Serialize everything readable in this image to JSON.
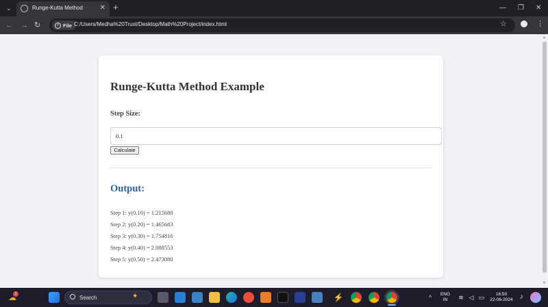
{
  "browser": {
    "tab_title": "Runge-Kutta Method",
    "site_chip": "File",
    "url": "C:/Users/Medha%20Trust/Desktop/Math%20Project/index.html"
  },
  "page": {
    "title": "Runge-Kutta Method Example",
    "step_size_label": "Step Size:",
    "step_size_value": "0.1",
    "calculate_label": "Calculate",
    "output_heading": "Output:",
    "results": [
      "Step 1: y(0.10) = 1.215688",
      "Step 2: y(0.20) = 1.465683",
      "Step 3: y(0.30) = 1.754816",
      "Step 4: y(0.40) = 2.088553",
      "Step 5: y(0.50) = 2.473080"
    ]
  },
  "taskbar": {
    "search_label": "Search",
    "notification_badge": "1",
    "language": "ENG",
    "region": "IN",
    "time": "16:50",
    "date": "22-06-2024"
  },
  "colors": {
    "output_heading": "#2a6496",
    "title": "#333333",
    "chrome_dark": "#202124"
  },
  "icons": [
    "tab-search-icon",
    "close-icon",
    "plus-icon",
    "back-icon",
    "forward-icon",
    "reload-icon",
    "info-icon",
    "star-icon",
    "profile-icon",
    "menu-icon",
    "windows-icon",
    "search-icon"
  ]
}
